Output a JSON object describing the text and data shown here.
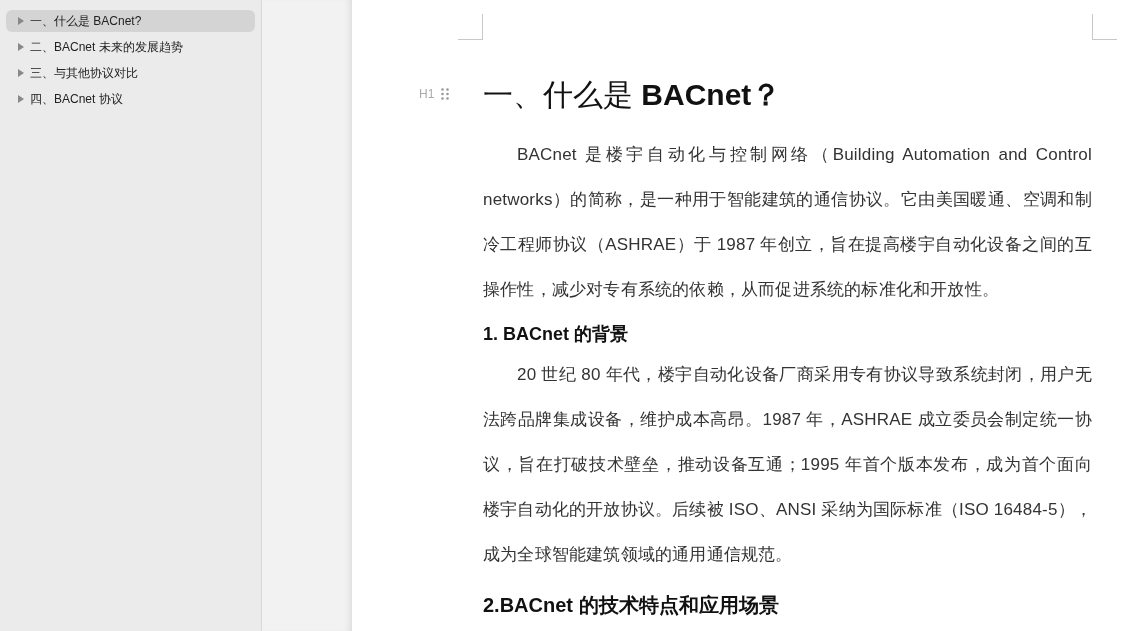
{
  "outline": [
    {
      "label": "一、什么是 BACnet?",
      "selected": true
    },
    {
      "label": "二、BACnet 未来的发展趋势",
      "selected": false
    },
    {
      "label": "三、与其他协议对比",
      "selected": false
    },
    {
      "label": "四、BACnet 协议",
      "selected": false
    }
  ],
  "document": {
    "heading_marker": "H1",
    "blocks": [
      {
        "kind": "h1",
        "text": "一、什么是 **BACnet？**"
      },
      {
        "kind": "p",
        "text": "BACnet 是楼宇自动化与控制网络（Building Automation and Control networks）的简称，是一种用于智能建筑的通信协议。它由美国暖通、空调和制冷工程师协议（ASHRAE）于 1987 年创立，旨在提高楼宇自动化设备之间的互操作性，减少对专有系统的依赖，从而促进系统的标准化和开放性。"
      },
      {
        "kind": "h3",
        "text": "1. BACnet 的背景"
      },
      {
        "kind": "p",
        "text": "20 世纪 80 年代，楼宇自动化设备厂商采用专有协议导致系统封闭，用户无法跨品牌集成设备，维护成本高昂。1987 年，ASHRAE 成立委员会制定统一协议，旨在打破技术壁垒，推动设备互通；1995 年首个版本发布，成为首个面向楼宇自动化的开放协议。后续被 ISO、ANSI 采纳为国际标准（ISO 16484-5），成为全球智能建筑领域的通用通信规范。"
      },
      {
        "kind": "h3",
        "text": "2.BACnet 的技术特点和应用场景"
      }
    ]
  }
}
